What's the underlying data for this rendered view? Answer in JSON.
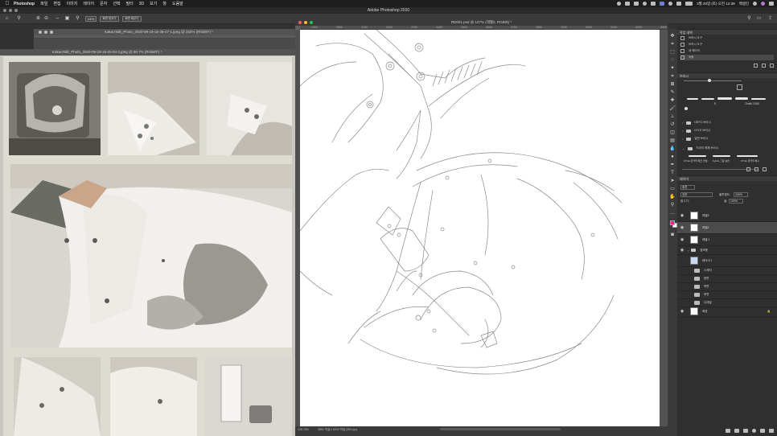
{
  "menubar": {
    "app_name": "Photoshop",
    "items": [
      "파일",
      "편집",
      "이미지",
      "레이어",
      "문자",
      "선택",
      "필터",
      "3D",
      "보기",
      "창",
      "도움말"
    ],
    "datetime": "3월 20일 (토) 오전 12:39",
    "user": "백랭인"
  },
  "app": {
    "title": "Adobe Photoshop 2020"
  },
  "options_bar": {
    "zoom_value": "100%",
    "fit_screen_label": "화면 맞추기",
    "fill_screen_label": "화면 채우기"
  },
  "documents": {
    "back": {
      "title": "KakaoTalk_Photo_2020-09-19-15-35-47-1.jpeg @ 232% (RGB/8*) *"
    },
    "photo": {
      "title": "KakaoTalk_Photo_2020-09-19-15-22-04-2.jpeg @ 66.7% (RGB/8*) *"
    },
    "main": {
      "title": "RD001.psd @ 127% (레벨2, RGB/8) *",
      "zoom": "126.78%",
      "doc_info": "3851 픽셀 x 5000 픽셀 (300 ppi)",
      "ruler_h": [
        "1900",
        "2000",
        "2100",
        "2200",
        "2300",
        "2400",
        "2500",
        "2600",
        "2700",
        "2800",
        "2900",
        "3000",
        "3100",
        "3200",
        "3300"
      ]
    }
  },
  "panels": {
    "history": {
      "tab": "작업 내역",
      "items": [
        "브러시 도구",
        "브러시 도구",
        "새 레이어",
        "이동"
      ]
    },
    "brushes": {
      "tab": "브러시",
      "size": "5",
      "brush_name": "Chalk 1000",
      "folders": [
        "DEFG 브러시",
        "KYLE 브러시",
        "일반 브러시",
        "드라이 매체 브러시"
      ],
      "presets": [
        "KYLE 궁극적 매크 연필",
        "KyleG 그림 실전",
        "KYLE 궁극적 특수"
      ]
    },
    "layers": {
      "tab": "레이어",
      "filter_label": "종류",
      "blend_mode": "표준",
      "opacity_label": "불투명도:",
      "opacity": "100%",
      "lock_label": "잠그기:",
      "fill_label": "칠:",
      "fill": "100%",
      "items": [
        {
          "name": "레벨3",
          "kind": "layer",
          "visible": true
        },
        {
          "name": "레벨2",
          "kind": "layer",
          "visible": true,
          "selected": true
        },
        {
          "name": "레벨 1",
          "kind": "layer",
          "visible": true
        },
        {
          "name": "참조용",
          "kind": "group",
          "visible": true
        },
        {
          "name": "레이어 1",
          "kind": "layer",
          "visible": false
        },
        {
          "name": "스케치",
          "kind": "group",
          "visible": false
        },
        {
          "name": "정면",
          "kind": "group",
          "visible": false
        },
        {
          "name": "측면",
          "kind": "group",
          "visible": false
        },
        {
          "name": "후면",
          "kind": "group",
          "visible": false
        },
        {
          "name": "디테일",
          "kind": "group",
          "visible": false
        },
        {
          "name": "배경",
          "kind": "layer",
          "visible": true
        }
      ]
    }
  },
  "colors": {
    "foreground": "#e5258c",
    "background": "#ffffff",
    "canvas": "#ffffff",
    "ui_dark": "#2f2f2f"
  },
  "icons": [
    "apple-icon",
    "search-icon",
    "wifi-icon",
    "battery-icon",
    "control-center-icon",
    "move-tool-icon",
    "marquee-tool-icon",
    "lasso-tool-icon",
    "brush-tool-icon",
    "eraser-tool-icon",
    "eye-icon",
    "folder-icon"
  ]
}
